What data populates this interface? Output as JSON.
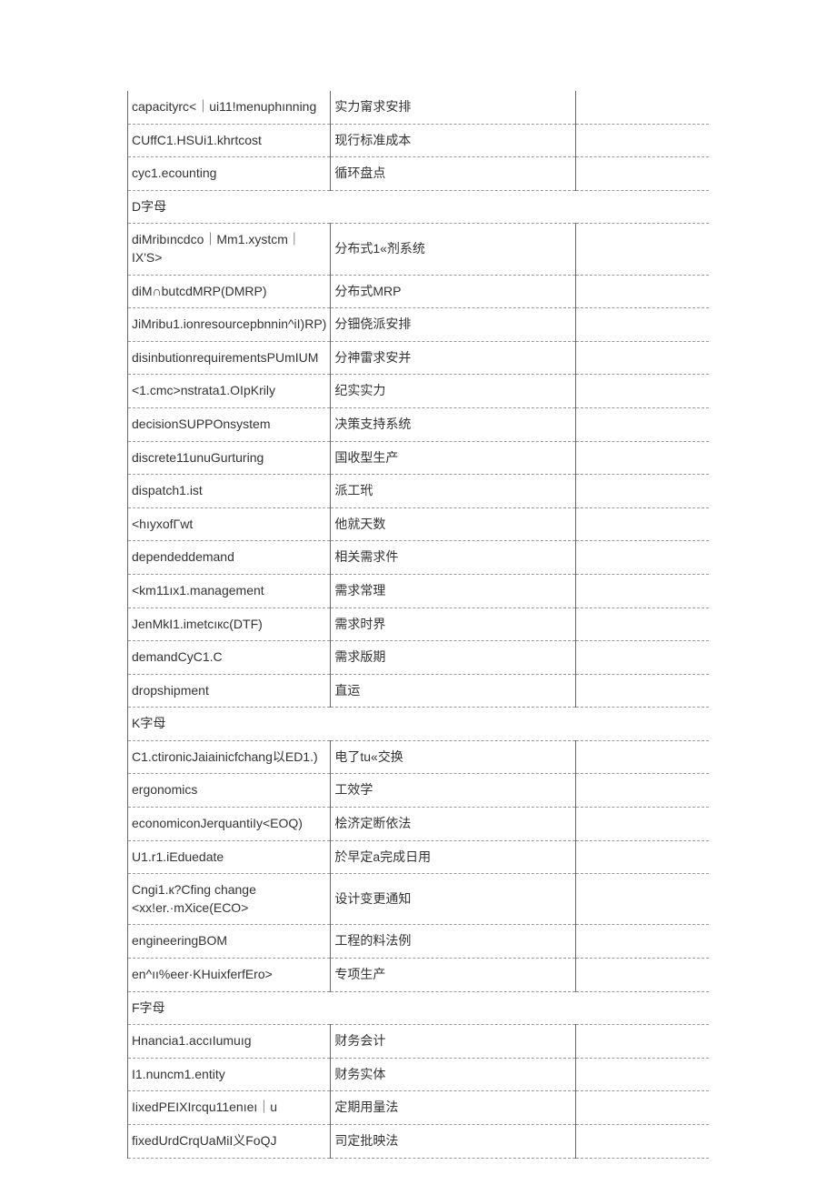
{
  "rows": [
    {
      "type": "row",
      "c1": "capacityrc<｜ui11!menuphınning",
      "c2": "实力甯求安排",
      "c3": ""
    },
    {
      "type": "row",
      "c1": "CUffC1.HSUi1.khrtcost",
      "c2": "现行标准成本",
      "c3": ""
    },
    {
      "type": "row",
      "c1": "cyc1.ecounting",
      "c2": "循环盘点",
      "c3": ""
    },
    {
      "type": "section",
      "label": "D字母"
    },
    {
      "type": "row",
      "c1": "diMribıncdco｜Mm1.xystcm｜IX'S>",
      "c2": "分布式1«剂系统",
      "c3": ""
    },
    {
      "type": "row",
      "c1": "diM∩butcdMRP(DMRP)",
      "c2": "分布式MRP",
      "c3": ""
    },
    {
      "type": "row",
      "c1": "JiMribu1.ionresourcepbnnin^iI)RP)",
      "c2": "分钿侥派安排",
      "c3": ""
    },
    {
      "type": "row",
      "c1": "disinbutionrequirementsPUmIUM",
      "c2": "分神雷求安并",
      "c3": ""
    },
    {
      "type": "row",
      "c1": "<1.cmc>nstrata1.OIpKrily",
      "c2": "纪实实力",
      "c3": ""
    },
    {
      "type": "row",
      "c1": "decisionSUPPOnsystem",
      "c2": "决策支持系统",
      "c3": ""
    },
    {
      "type": "row",
      "c1": "discrete11unuGurturing",
      "c2": "国收型生产",
      "c3": ""
    },
    {
      "type": "row",
      "c1": "dispatch1.ist",
      "c2": "派工玳",
      "c3": ""
    },
    {
      "type": "row",
      "c1": "<hıyxofΓwt",
      "c2": "他就天数",
      "c3": ""
    },
    {
      "type": "row",
      "c1": "dependeddemand",
      "c2": "相关需求件",
      "c3": ""
    },
    {
      "type": "row",
      "c1": "<km11ıx1.management",
      "c2": "需求常理",
      "c3": ""
    },
    {
      "type": "row",
      "c1": "JenMkI1.imetcıкc(DTF)",
      "c2": "需求时界",
      "c3": ""
    },
    {
      "type": "row",
      "c1": "demandCyC1.C",
      "c2": "需求版期",
      "c3": ""
    },
    {
      "type": "row",
      "c1": "dropshipment",
      "c2": "直运",
      "c3": ""
    },
    {
      "type": "section",
      "label": "K字母"
    },
    {
      "type": "row",
      "c1": "C1.ctironicJaiainicfchang以ED1.)",
      "c2": "电了tu«交换",
      "c3": ""
    },
    {
      "type": "row",
      "c1": "ergonomics",
      "c2": "工效学",
      "c3": ""
    },
    {
      "type": "row",
      "c1": "economiconJerquantiIy<EOQ)",
      "c2": "桧济定断依法",
      "c3": ""
    },
    {
      "type": "row",
      "c1": "U1.r1.iEduedate",
      "c2": "於早定a完成日用",
      "c3": ""
    },
    {
      "type": "row",
      "c1": "Cngi1.к?Cfing change <xx!er.·mXice(ECO>",
      "c2": "设计变更通知",
      "c3": ""
    },
    {
      "type": "row",
      "c1": "engineeringBOM",
      "c2": "工程的料法例",
      "c3": ""
    },
    {
      "type": "row",
      "c1": "en^ıı%eer·KHuixferfEro>",
      "c2": "专项生产",
      "c3": ""
    },
    {
      "type": "section",
      "label": "F字母"
    },
    {
      "type": "row",
      "c1": "Hnancia1.accıIumuıg",
      "c2": "财务会计",
      "c3": ""
    },
    {
      "type": "row",
      "c1": "I1.nuncm1.entity",
      "c2": "财务实体",
      "c3": ""
    },
    {
      "type": "row",
      "c1": "IixedPEIXIrcqu11enıeı｜u",
      "c2": "定期用量法",
      "c3": ""
    },
    {
      "type": "row",
      "c1": "fixedUrdCrqUaMiI义FoQJ",
      "c2": "司定批映法",
      "c3": ""
    }
  ]
}
